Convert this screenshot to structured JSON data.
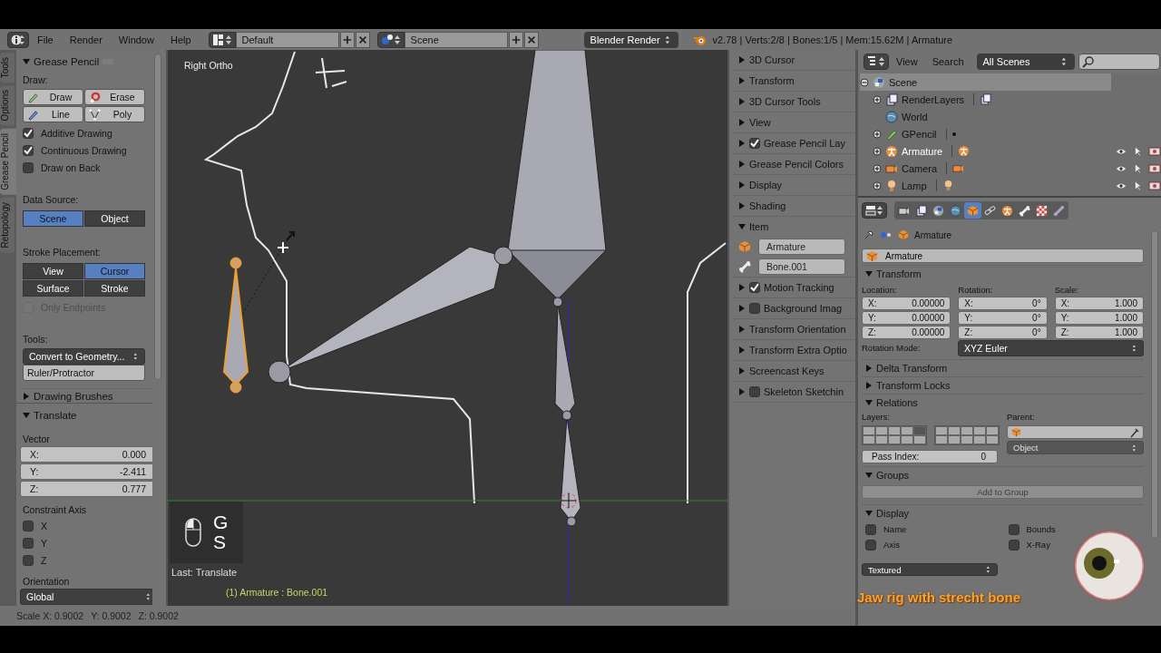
{
  "header": {
    "menus": [
      "File",
      "Render",
      "Window",
      "Help"
    ],
    "layout": "Default",
    "scene": "Scene",
    "engine": "Blender Render",
    "stats": "v2.78 | Verts:2/8 | Bones:1/5 | Mem:15.62M | Armature"
  },
  "tool_shelf": {
    "tabs": [
      {
        "label": "Tools",
        "selected": false
      },
      {
        "label": "Options",
        "selected": false
      },
      {
        "label": "Grease Pencil",
        "selected": true
      },
      {
        "label": "Retopology",
        "selected": false
      }
    ],
    "panel": {
      "title": "Grease Pencil",
      "expanded": true,
      "draw_label": "Draw:",
      "draw_tools": [
        {
          "label": "Draw",
          "kind": "pencil"
        },
        {
          "label": "Erase",
          "kind": "eraser"
        },
        {
          "label": "Line",
          "kind": "line"
        },
        {
          "label": "Poly",
          "kind": "poly"
        }
      ],
      "draw_options": [
        {
          "label": "Additive Drawing",
          "checked": true
        },
        {
          "label": "Continuous Drawing",
          "checked": true
        },
        {
          "label": "Draw on Back",
          "checked": false
        }
      ],
      "data_source": {
        "label": "Data Source:",
        "options": [
          {
            "label": "Scene",
            "selected": true
          },
          {
            "label": "Object",
            "selected": false
          }
        ]
      },
      "stroke_placement": {
        "label": "Stroke Placement:",
        "options": [
          {
            "label": "View",
            "selected": false
          },
          {
            "label": "Cursor",
            "selected": true
          },
          {
            "label": "Surface",
            "selected": false
          },
          {
            "label": "Stroke",
            "selected": false
          }
        ]
      },
      "only_endpoints": {
        "label": "Only Endpoints",
        "checked": false,
        "disabled": true
      },
      "tools_label": "Tools:",
      "convert": "Convert to Geometry...",
      "ruler": "Ruler/Protractor"
    },
    "next_panel": {
      "title": "Drawing Brushes",
      "expanded": false
    }
  },
  "operator": {
    "title": "Translate",
    "expanded": true,
    "vector_label": "Vector",
    "vector": [
      {
        "axis": "X:",
        "value": "0.000"
      },
      {
        "axis": "Y:",
        "value": "-2.411"
      },
      {
        "axis": "Z:",
        "value": "0.777"
      }
    ],
    "constraint_label": "Constraint Axis",
    "constraints": [
      {
        "label": "X",
        "checked": false
      },
      {
        "label": "Y",
        "checked": false
      },
      {
        "label": "Z",
        "checked": false
      }
    ],
    "orientation_label": "Orientation",
    "orientation": "Global"
  },
  "viewport": {
    "view_name": "Right Ortho",
    "keys": [
      "G",
      "S"
    ],
    "last_operator": "Last: Translate",
    "active": "(1) Armature : Bone.001"
  },
  "n_panel": {
    "panels": [
      {
        "title": "3D Cursor",
        "kind": "plain",
        "expanded": false
      },
      {
        "title": "Transform",
        "kind": "plain",
        "expanded": false
      },
      {
        "title": "3D Cursor Tools",
        "kind": "plain",
        "expanded": false
      },
      {
        "title": "View",
        "kind": "plain",
        "expanded": false
      },
      {
        "title": "Grease Pencil Lay",
        "kind": "toggle",
        "expanded": false,
        "checked": true
      },
      {
        "title": "Grease Pencil Colors",
        "kind": "plain",
        "expanded": false
      },
      {
        "title": "Display",
        "kind": "plain",
        "expanded": false
      },
      {
        "title": "Shading",
        "kind": "plain",
        "expanded": false
      },
      {
        "title": "Item",
        "kind": "item",
        "expanded": true,
        "object": "Armature",
        "bone": "Bone.001"
      },
      {
        "title": "Motion Tracking",
        "kind": "toggle",
        "expanded": false,
        "checked": true
      },
      {
        "title": "Background Imag",
        "kind": "toggle",
        "expanded": false,
        "checked": false
      },
      {
        "title": "Transform Orientation",
        "kind": "plain",
        "expanded": false
      },
      {
        "title": "Transform Extra Optio",
        "kind": "plain",
        "expanded": false
      },
      {
        "title": "Screencast Keys",
        "kind": "plain",
        "expanded": false
      },
      {
        "title": "Skeleton Sketchin",
        "kind": "toggle",
        "expanded": false,
        "checked": false
      }
    ]
  },
  "outliner": {
    "menus": [
      "View",
      "Search"
    ],
    "filter": "All Scenes",
    "tree": [
      {
        "label": "Scene",
        "kind": "scene",
        "expanded": true,
        "selected": true,
        "active": false,
        "children": [
          {
            "label": "RenderLayers",
            "kind": "renderlayers",
            "expanded": false,
            "selected": false,
            "active": false
          },
          {
            "label": "World",
            "kind": "world",
            "selected": false,
            "active": false
          },
          {
            "label": "GPencil",
            "kind": "gpencil",
            "expanded": false,
            "selected": false,
            "active": false
          },
          {
            "label": "Armature",
            "kind": "armature",
            "expanded": false,
            "selected": false,
            "active": true
          },
          {
            "label": "Camera",
            "kind": "camera",
            "expanded": false,
            "selected": false,
            "active": false
          },
          {
            "label": "Lamp",
            "kind": "lamp",
            "expanded": false,
            "selected": false,
            "active": false
          }
        ]
      }
    ]
  },
  "properties": {
    "tabs": [
      {
        "kind": "render",
        "selected": false
      },
      {
        "kind": "layers",
        "selected": false
      },
      {
        "kind": "scene",
        "selected": false
      },
      {
        "kind": "world",
        "selected": false
      },
      {
        "kind": "object",
        "selected": true
      },
      {
        "kind": "constraint",
        "selected": false
      },
      {
        "kind": "armature",
        "selected": false
      },
      {
        "kind": "bone",
        "selected": false
      },
      {
        "kind": "texture",
        "selected": false
      },
      {
        "kind": "bone_constraint",
        "selected": false
      }
    ],
    "breadcrumb": "Armature",
    "object_name": "Armature",
    "transform": {
      "title": "Transform",
      "expanded": true,
      "groups": [
        {
          "label": "Location:",
          "fields": [
            {
              "axis": "X:",
              "value": "0.00000"
            },
            {
              "axis": "Y:",
              "value": "0.00000"
            },
            {
              "axis": "Z:",
              "value": "0.00000"
            }
          ]
        },
        {
          "label": "Rotation:",
          "fields": [
            {
              "axis": "X:",
              "value": "0°"
            },
            {
              "axis": "Y:",
              "value": "0°"
            },
            {
              "axis": "Z:",
              "value": "0°"
            }
          ]
        },
        {
          "label": "Scale:",
          "fields": [
            {
              "axis": "X:",
              "value": "1.000"
            },
            {
              "axis": "Y:",
              "value": "1.000"
            },
            {
              "axis": "Z:",
              "value": "1.000"
            }
          ]
        }
      ],
      "rotation_mode_label": "Rotation Mode:",
      "rotation_mode": "XYZ Euler"
    },
    "collapsed": [
      {
        "title": "Delta Transform",
        "expanded": false
      },
      {
        "title": "Transform Locks",
        "expanded": false
      }
    ],
    "relations": {
      "title": "Relations",
      "expanded": true,
      "layers_label": "Layers:",
      "layers": [
        false,
        false,
        false,
        false,
        true,
        false,
        false,
        false,
        false,
        false,
        false,
        false,
        false,
        false,
        false,
        false,
        false,
        false,
        false,
        false
      ],
      "parent_label": "Parent:",
      "parent_type": "Object",
      "pass_index_label": "Pass Index:",
      "pass_index": "0"
    },
    "groups": {
      "title": "Groups",
      "expanded": true,
      "add_button": "Add to Group"
    },
    "display": {
      "title": "Display",
      "expanded": true,
      "options": [
        {
          "label": "Name",
          "checked": false
        },
        {
          "label": "Bounds",
          "checked": false
        },
        {
          "label": "Axis",
          "checked": false
        },
        {
          "label": "X-Ray",
          "checked": false
        }
      ],
      "draw_type": "Textured"
    }
  },
  "status_bar": {
    "items": [
      "Scale X: 0.9002",
      "Y: 0.9002",
      "Z: 0.9002"
    ]
  },
  "overlay": {
    "caption": "Jaw rig with strecht bone"
  }
}
